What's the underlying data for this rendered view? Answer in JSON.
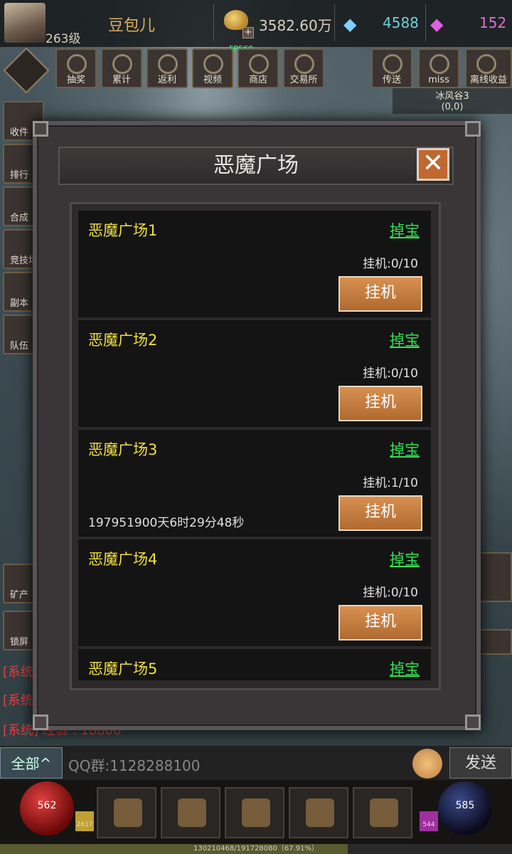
{
  "player": {
    "level": "263级",
    "name": "豆包儿"
  },
  "currency": {
    "gold": "3582.60万",
    "gold_plus": "+",
    "diamond": "4588",
    "gem": "152"
  },
  "fps": "FPS60",
  "menu": [
    "抽奖",
    "累计",
    "返利",
    "视频",
    "商店",
    "交易所"
  ],
  "menu_right": [
    "传送",
    "miss",
    "离线收益"
  ],
  "map": {
    "name": "冰风谷3",
    "coords": "(0,0)"
  },
  "side": [
    "收件",
    "排行",
    "合成",
    "竞技场",
    "副本",
    "队伍"
  ],
  "side_lower": [
    "矿产",
    "锁屏"
  ],
  "chat": {
    "lines": [
      "[系统]",
      "[系统]",
      "[系统]  经验 : 18800"
    ],
    "all_label": "全部^",
    "qq": "QQ群:1128288100",
    "send_label": "发送"
  },
  "bottom": {
    "hp": "562",
    "mp": "585",
    "potion_left": "2617",
    "potion_right": "544",
    "exp_text": "130210468/191728080（67.91%）",
    "exp_percent": 67.91
  },
  "modal": {
    "title": "恶魔广场",
    "close": "✕",
    "items": [
      {
        "name": "恶魔广场1",
        "drop": "掉宝",
        "count": "挂机:0/10",
        "button": "挂机"
      },
      {
        "name": "恶魔广场2",
        "drop": "掉宝",
        "count": "挂机:0/10",
        "button": "挂机"
      },
      {
        "name": "恶魔广场3",
        "drop": "掉宝",
        "count": "挂机:1/10",
        "button": "挂机",
        "timer": "197951900天6时29分48秒"
      },
      {
        "name": "恶魔广场4",
        "drop": "掉宝",
        "count": "挂机:0/10",
        "button": "挂机"
      },
      {
        "name": "恶魔广场5",
        "drop": "掉宝"
      }
    ]
  }
}
